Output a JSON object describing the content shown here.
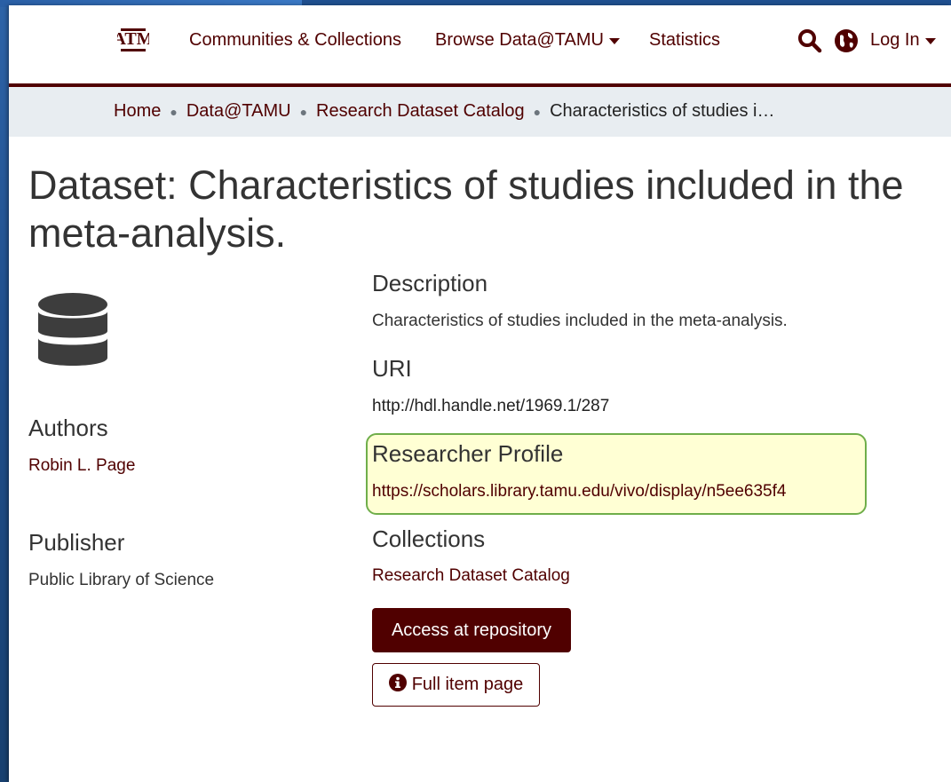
{
  "header": {
    "logo_text": "ATM",
    "nav": {
      "communities": "Communities & Collections",
      "browse": "Browse Data@TAMU",
      "statistics": "Statistics",
      "login": "Log In"
    },
    "icons": [
      "search-icon",
      "globe-icon",
      "caret-down-icon"
    ]
  },
  "breadcrumb": {
    "items": [
      "Home",
      "Data@TAMU",
      "Research Dataset Catalog"
    ],
    "current": "Characteristics of studies i…"
  },
  "title": "Dataset: Characteristics of studies included in the meta-analysis.",
  "left": {
    "icon": "database-icon",
    "authors_label": "Authors",
    "author": "Robin L. Page",
    "publisher_label": "Publisher",
    "publisher": "Public Library of Science"
  },
  "main": {
    "description_label": "Description",
    "description": "Characteristics of studies included in the meta-analysis.",
    "uri_label": "URI",
    "uri": "http://hdl.handle.net/1969.1/287",
    "researcher_label": "Researcher Profile",
    "researcher_url": "https://scholars.library.tamu.edu/vivo/display/n5ee635f4",
    "collections_label": "Collections",
    "collection": "Research Dataset Catalog",
    "access_button": "Access at repository",
    "full_item_button": "Full item page"
  },
  "colors": {
    "brand": "#500000",
    "breadcrumb_bg": "#e8edf1",
    "highlight_bg": "#ffffd4",
    "highlight_border": "#6fae4a"
  }
}
